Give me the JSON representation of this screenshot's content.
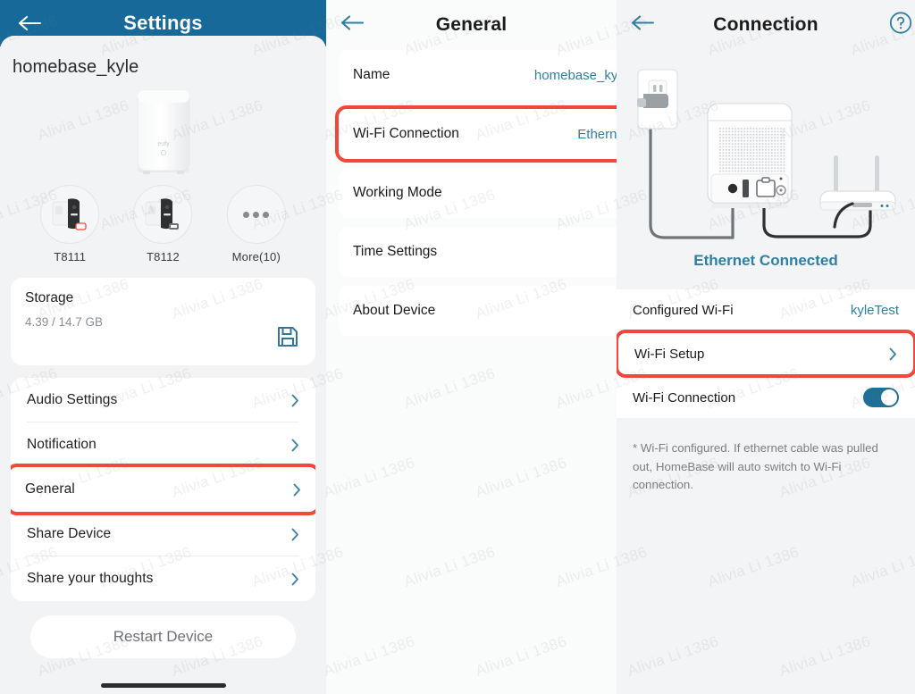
{
  "theme": {
    "header_blue": "#17699a",
    "accent_teal": "#2f7fa3",
    "highlight_red": "#f4473c",
    "page_bg": "#f2f3f4",
    "card_bg": "#ffffff",
    "muted_text": "#8b8f93"
  },
  "watermark": {
    "text": "Alivia Li 1386"
  },
  "settings_panel": {
    "header": {
      "title": "Settings",
      "back_icon": "back-arrow-icon"
    },
    "device_name": "homebase_kyle",
    "hero_device_icon": "homebase-device-icon",
    "devices": [
      {
        "label": "T8111",
        "icon": "camera-device-icon",
        "badge": "battery-empty-badge"
      },
      {
        "label": "T8112",
        "icon": "camera-device-icon",
        "badge": "battery-full-badge"
      },
      {
        "label": "More(10)",
        "icon": "more-dots-icon",
        "badge": ""
      }
    ],
    "storage": {
      "title": "Storage",
      "usage": "4.39 / 14.7 GB",
      "icon": "floppy-save-icon"
    },
    "menu": [
      {
        "label": "Audio Settings",
        "chevron": "chevron-right-icon",
        "highlighted": false
      },
      {
        "label": "Notification",
        "chevron": "chevron-right-icon",
        "highlighted": false
      },
      {
        "label": "General",
        "chevron": "chevron-right-icon",
        "highlighted": true
      },
      {
        "label": "Share Device",
        "chevron": "chevron-right-icon",
        "highlighted": false
      },
      {
        "label": "Share your thoughts",
        "chevron": "chevron-right-icon",
        "highlighted": false
      }
    ],
    "restart_button": "Restart Device"
  },
  "general_panel": {
    "header": {
      "title": "General",
      "back_icon": "back-arrow-icon"
    },
    "rows": [
      {
        "label": "Name",
        "value": "homebase_kyle",
        "highlighted": false
      },
      {
        "label": "Wi-Fi Connection",
        "value": "Ethernet",
        "highlighted": true
      },
      {
        "label": "Working Mode",
        "value": "",
        "highlighted": false
      },
      {
        "label": "Time Settings",
        "value": "",
        "highlighted": false
      },
      {
        "label": "About Device",
        "value": "",
        "highlighted": false
      }
    ]
  },
  "connection_panel": {
    "header": {
      "title": "Connection",
      "back_icon": "back-arrow-icon",
      "help_icon": "help-question-icon"
    },
    "illustration": {
      "name": "ethernet-wiring-diagram",
      "parts": [
        "wall-outlet-icon",
        "power-plug-icon",
        "homebase-rear-icon",
        "router-icon",
        "ethernet-cable"
      ]
    },
    "status_text": "Ethernet Connected",
    "rows": [
      {
        "label": "Configured Wi-Fi",
        "value": "kyleTest",
        "type": "value",
        "highlighted": false
      },
      {
        "label": "Wi-Fi Setup",
        "value": "",
        "type": "chevron",
        "highlighted": true
      },
      {
        "label": "Wi-Fi Connection",
        "value": "",
        "type": "toggle",
        "toggle_on": true,
        "highlighted": false
      }
    ],
    "note": "* Wi-Fi configured. If ethernet cable was pulled out, HomeBase will auto switch to Wi-Fi connection."
  }
}
